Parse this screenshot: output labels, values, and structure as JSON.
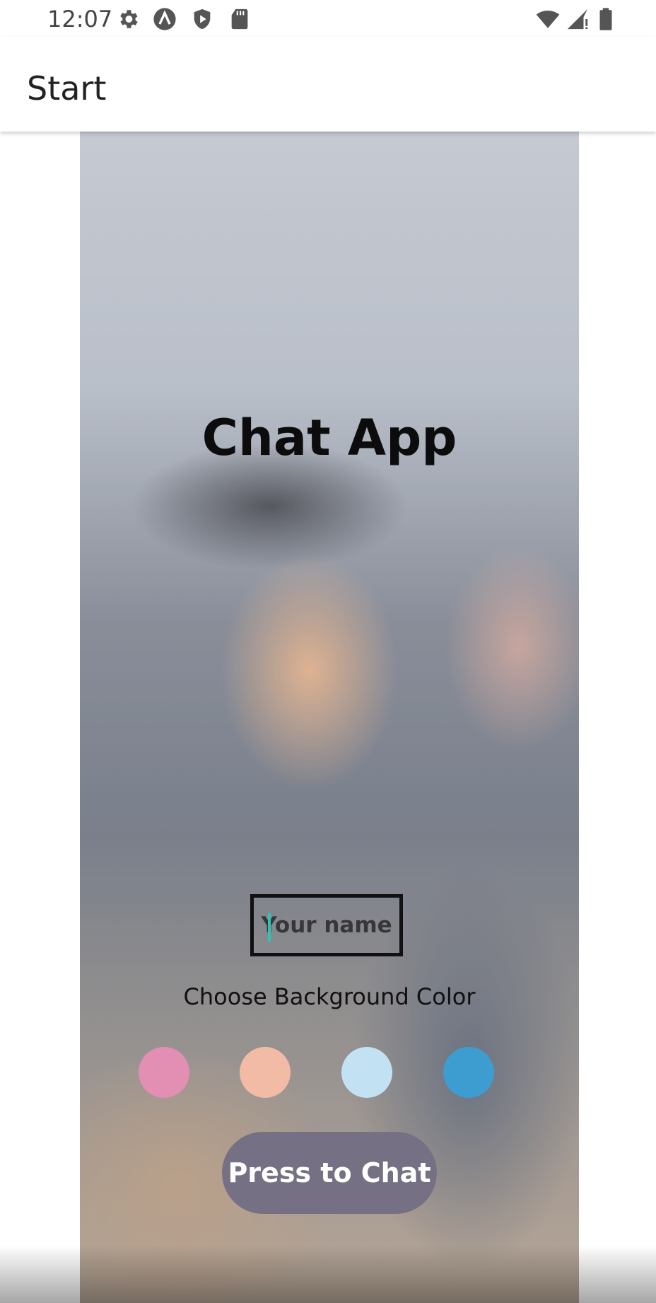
{
  "status_bar": {
    "time": "12:07",
    "left_icons": [
      "gear-icon",
      "app-a-icon",
      "shield-play-icon",
      "sd-card-icon"
    ],
    "right_icons": [
      "wifi-icon",
      "signal-icon",
      "battery-icon"
    ]
  },
  "app_bar": {
    "title": "Start"
  },
  "screen": {
    "title": "Chat App",
    "name_input": {
      "placeholder": "Your name",
      "value": ""
    },
    "color_label": "Choose Background Color",
    "colors": [
      "#E38EB3",
      "#F2BBA6",
      "#C2E2F4",
      "#3E9DD0"
    ],
    "chat_button_label": "Press to Chat",
    "chat_button_color": "#757083"
  }
}
